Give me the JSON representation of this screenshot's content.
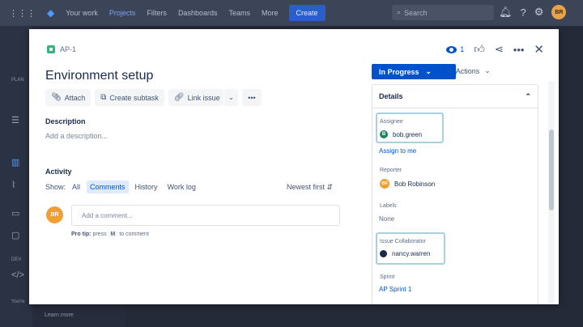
{
  "nav": {
    "items": [
      "Your work",
      "Projects",
      "Filters",
      "Dashboards",
      "Teams",
      "More"
    ],
    "create": "Create",
    "search_placeholder": "Search",
    "user_initials": "BR"
  },
  "sidebar_bg": {
    "plan_label": "PLAN",
    "dev_label": "DEV",
    "youre_text": "You're",
    "learn_more": "Learn more"
  },
  "issue": {
    "key": "AP-1",
    "title": "Environment setup",
    "watch_count": "1",
    "actions": {
      "attach": "Attach",
      "create_subtask": "Create subtask",
      "link_issue": "Link issue"
    },
    "description_label": "Description",
    "description_placeholder": "Add a description...",
    "activity_label": "Activity",
    "show_label": "Show:",
    "tabs": [
      "All",
      "Comments",
      "History",
      "Work log"
    ],
    "sort": "Newest first",
    "commenter_initials": "BR",
    "comment_placeholder": "Add a comment...",
    "protip": {
      "prefix": "Pro tip:",
      "press": "press",
      "key": "M",
      "suffix": "to comment"
    }
  },
  "panel": {
    "status": "In Progress",
    "actions": "Actions",
    "details_title": "Details",
    "fields": {
      "assignee_label": "Assignee",
      "assignee_value": "bob.green",
      "assignee_initial": "B",
      "assign_to_me": "Assign to me",
      "reporter_label": "Reporter",
      "reporter_value": "Bob Robinson",
      "reporter_initials": "BR",
      "labels_label": "Labels",
      "labels_value": "None",
      "collab_label": "Issue Collaborator",
      "collab_value": "nancy.warren",
      "sprint_label": "Sprint",
      "sprint_value": "AP Sprint 1"
    }
  },
  "colors": {
    "primary": "#0052cc",
    "story": "#36b37e",
    "assignee_avatar": "#1f845a",
    "reporter_avatar": "#f0a030",
    "collab_avatar": "#172b4d"
  }
}
